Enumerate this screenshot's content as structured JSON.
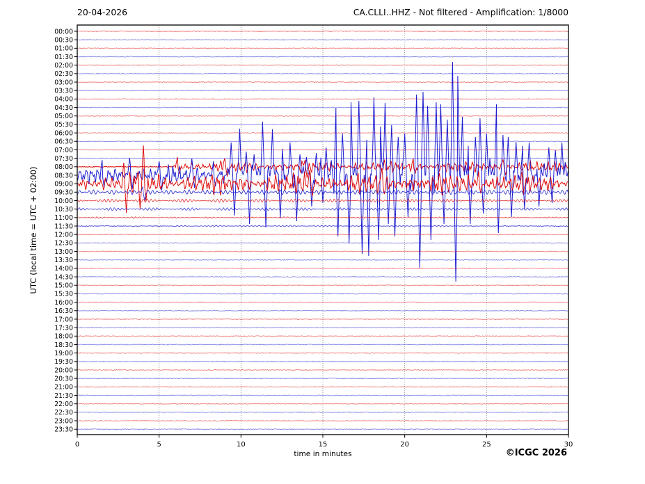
{
  "header": {
    "date": "20-04-2026",
    "title": "CA.CLLI..HHZ - Not filtered - Amplification: 1/8000"
  },
  "axes": {
    "y_label": "UTC (local time = UTC + 02:00)",
    "x_label": "time in minutes",
    "x_ticks": [
      0,
      5,
      10,
      15,
      20,
      25,
      30
    ],
    "x_range_minutes": [
      0,
      30
    ],
    "grid_minutes": [
      5,
      10,
      15,
      20,
      25
    ],
    "row_interval_minutes": 30
  },
  "footer": {
    "copyright": "©ICGC 2026"
  },
  "colors": {
    "trace_red": "#dd0000",
    "trace_blue": "#1111cc",
    "grid": "#888888",
    "frame": "#000000",
    "background": "#ffffff"
  },
  "chart_data": {
    "type": "line",
    "kind": "helicorder-daily-seismogram",
    "legend_position": "none",
    "grid": "vertical-dotted-5min",
    "rows": [
      {
        "label": "00:00",
        "color": "red",
        "act": "flat"
      },
      {
        "label": "00:30",
        "color": "blue",
        "act": "flat"
      },
      {
        "label": "01:00",
        "color": "red",
        "act": "flat"
      },
      {
        "label": "01:30",
        "color": "blue",
        "act": "flat"
      },
      {
        "label": "02:00",
        "color": "red",
        "act": "flat"
      },
      {
        "label": "02:30",
        "color": "blue",
        "act": "flat"
      },
      {
        "label": "03:00",
        "color": "red",
        "act": "flat"
      },
      {
        "label": "03:30",
        "color": "blue",
        "act": "flat"
      },
      {
        "label": "04:00",
        "color": "red",
        "act": "flat"
      },
      {
        "label": "04:30",
        "color": "blue",
        "act": "flat"
      },
      {
        "label": "05:00",
        "color": "red",
        "act": "flat"
      },
      {
        "label": "05:30",
        "color": "blue",
        "act": "flat"
      },
      {
        "label": "06:00",
        "color": "red",
        "act": "flat"
      },
      {
        "label": "06:30",
        "color": "blue",
        "act": "flat"
      },
      {
        "label": "07:00",
        "color": "red",
        "act": "flat"
      },
      {
        "label": "07:30",
        "color": "blue",
        "act": "flat"
      },
      {
        "label": "08:00",
        "color": "red",
        "act": "tremor",
        "amp": 6.5,
        "start": 5.8,
        "bursts": [
          [
            6.1,
            14,
            10
          ],
          [
            9.0,
            12,
            14
          ],
          [
            13.9,
            10,
            16
          ],
          [
            20.5,
            12,
            10
          ],
          [
            26.0,
            10,
            12
          ]
        ]
      },
      {
        "label": "08:30",
        "color": "blue",
        "act": "comb",
        "amp": 11,
        "bursts": [
          [
            1.5,
            22,
            18
          ],
          [
            3.2,
            25,
            20
          ],
          [
            5.0,
            20,
            22
          ],
          [
            7.0,
            24,
            18
          ],
          [
            8.3,
            20,
            16
          ]
        ],
        "spikes_up": [
          [
            9.4,
            47
          ],
          [
            9.9,
            67
          ],
          [
            10.3,
            34
          ],
          [
            10.8,
            30
          ],
          [
            11.3,
            77
          ],
          [
            11.9,
            66
          ],
          [
            12.5,
            38
          ],
          [
            13.0,
            47
          ],
          [
            13.6,
            30
          ],
          [
            14.0,
            26
          ],
          [
            14.6,
            32
          ],
          [
            15.2,
            40
          ],
          [
            15.8,
            97
          ],
          [
            16.2,
            60
          ],
          [
            16.7,
            105
          ],
          [
            17.2,
            107
          ],
          [
            17.7,
            80
          ],
          [
            18.1,
            112
          ],
          [
            18.5,
            70
          ],
          [
            18.8,
            104
          ],
          [
            19.2,
            72
          ],
          [
            19.6,
            55
          ],
          [
            20.0,
            60
          ],
          [
            20.7,
            116
          ],
          [
            21.1,
            120
          ],
          [
            21.4,
            100
          ],
          [
            21.9,
            105
          ],
          [
            22.2,
            102
          ],
          [
            22.6,
            80
          ],
          [
            22.9,
            163
          ],
          [
            23.25,
            143
          ],
          [
            23.5,
            84
          ],
          [
            23.9,
            66
          ],
          [
            24.3,
            55
          ],
          [
            24.6,
            82
          ],
          [
            25.0,
            60
          ],
          [
            25.6,
            102
          ],
          [
            26.0,
            58
          ],
          [
            26.3,
            55
          ],
          [
            26.8,
            48
          ],
          [
            27.2,
            42
          ],
          [
            27.6,
            47
          ],
          [
            28.2,
            38
          ],
          [
            28.8,
            40
          ],
          [
            29.2,
            36
          ],
          [
            29.6,
            47
          ]
        ],
        "spikes_down": [
          [
            9.6,
            58
          ],
          [
            10.5,
            70
          ],
          [
            11.5,
            75
          ],
          [
            12.4,
            62
          ],
          [
            13.4,
            66
          ],
          [
            14.3,
            45
          ],
          [
            15.0,
            40
          ],
          [
            15.9,
            88
          ],
          [
            16.6,
            98
          ],
          [
            17.4,
            113
          ],
          [
            17.8,
            116
          ],
          [
            18.4,
            93
          ],
          [
            19.0,
            70
          ],
          [
            19.4,
            88
          ],
          [
            20.2,
            60
          ],
          [
            20.9,
            133
          ],
          [
            21.6,
            93
          ],
          [
            22.4,
            70
          ],
          [
            23.1,
            153
          ],
          [
            24.0,
            70
          ],
          [
            24.8,
            55
          ],
          [
            25.7,
            83
          ],
          [
            26.5,
            60
          ],
          [
            27.3,
            48
          ],
          [
            28.2,
            45
          ],
          [
            29.0,
            40
          ]
        ]
      },
      {
        "label": "09:00",
        "color": "red",
        "act": "tremor",
        "amp": 12,
        "bursts": [
          [
            2.85,
            30,
            42
          ],
          [
            3.7,
            18,
            36
          ],
          [
            4.05,
            55,
            25
          ],
          [
            14.2,
            20,
            18
          ],
          [
            18.6,
            22,
            15
          ],
          [
            24.5,
            18,
            14
          ]
        ]
      },
      {
        "label": "09:30",
        "color": "blue",
        "act": "wavelet",
        "amp": 3.2,
        "bursts": [
          [
            4.0,
            8,
            12
          ]
        ]
      },
      {
        "label": "10:00",
        "color": "red",
        "act": "ripple",
        "amp": 2.3
      },
      {
        "label": "10:30",
        "color": "blue",
        "act": "ripple",
        "amp": 2.0
      },
      {
        "label": "11:00",
        "color": "red",
        "act": "ripple",
        "amp": 0.9
      },
      {
        "label": "11:30",
        "color": "blue",
        "act": "ripple",
        "amp": 0.9,
        "start": 6,
        "end": 24
      },
      {
        "label": "12:00",
        "color": "red",
        "act": "flat"
      },
      {
        "label": "12:30",
        "color": "blue",
        "act": "flat"
      },
      {
        "label": "13:00",
        "color": "red",
        "act": "flat"
      },
      {
        "label": "13:30",
        "color": "blue",
        "act": "flat"
      },
      {
        "label": "14:00",
        "color": "red",
        "act": "flat"
      },
      {
        "label": "14:30",
        "color": "blue",
        "act": "flat"
      },
      {
        "label": "15:00",
        "color": "red",
        "act": "flat"
      },
      {
        "label": "15:30",
        "color": "blue",
        "act": "flat"
      },
      {
        "label": "16:00",
        "color": "red",
        "act": "flat"
      },
      {
        "label": "16:30",
        "color": "blue",
        "act": "flat"
      },
      {
        "label": "17:00",
        "color": "red",
        "act": "flat"
      },
      {
        "label": "17:30",
        "color": "blue",
        "act": "flat"
      },
      {
        "label": "18:00",
        "color": "red",
        "act": "flat"
      },
      {
        "label": "18:30",
        "color": "blue",
        "act": "flat"
      },
      {
        "label": "19:00",
        "color": "red",
        "act": "flat"
      },
      {
        "label": "19:30",
        "color": "blue",
        "act": "flat"
      },
      {
        "label": "20:00",
        "color": "red",
        "act": "flat"
      },
      {
        "label": "20:30",
        "color": "blue",
        "act": "flat"
      },
      {
        "label": "21:00",
        "color": "red",
        "act": "flat"
      },
      {
        "label": "21:30",
        "color": "blue",
        "act": "flat"
      },
      {
        "label": "22:00",
        "color": "red",
        "act": "flat"
      },
      {
        "label": "22:30",
        "color": "blue",
        "act": "flat"
      },
      {
        "label": "23:00",
        "color": "red",
        "act": "flat"
      },
      {
        "label": "23:30",
        "color": "blue",
        "act": "flat"
      }
    ]
  }
}
